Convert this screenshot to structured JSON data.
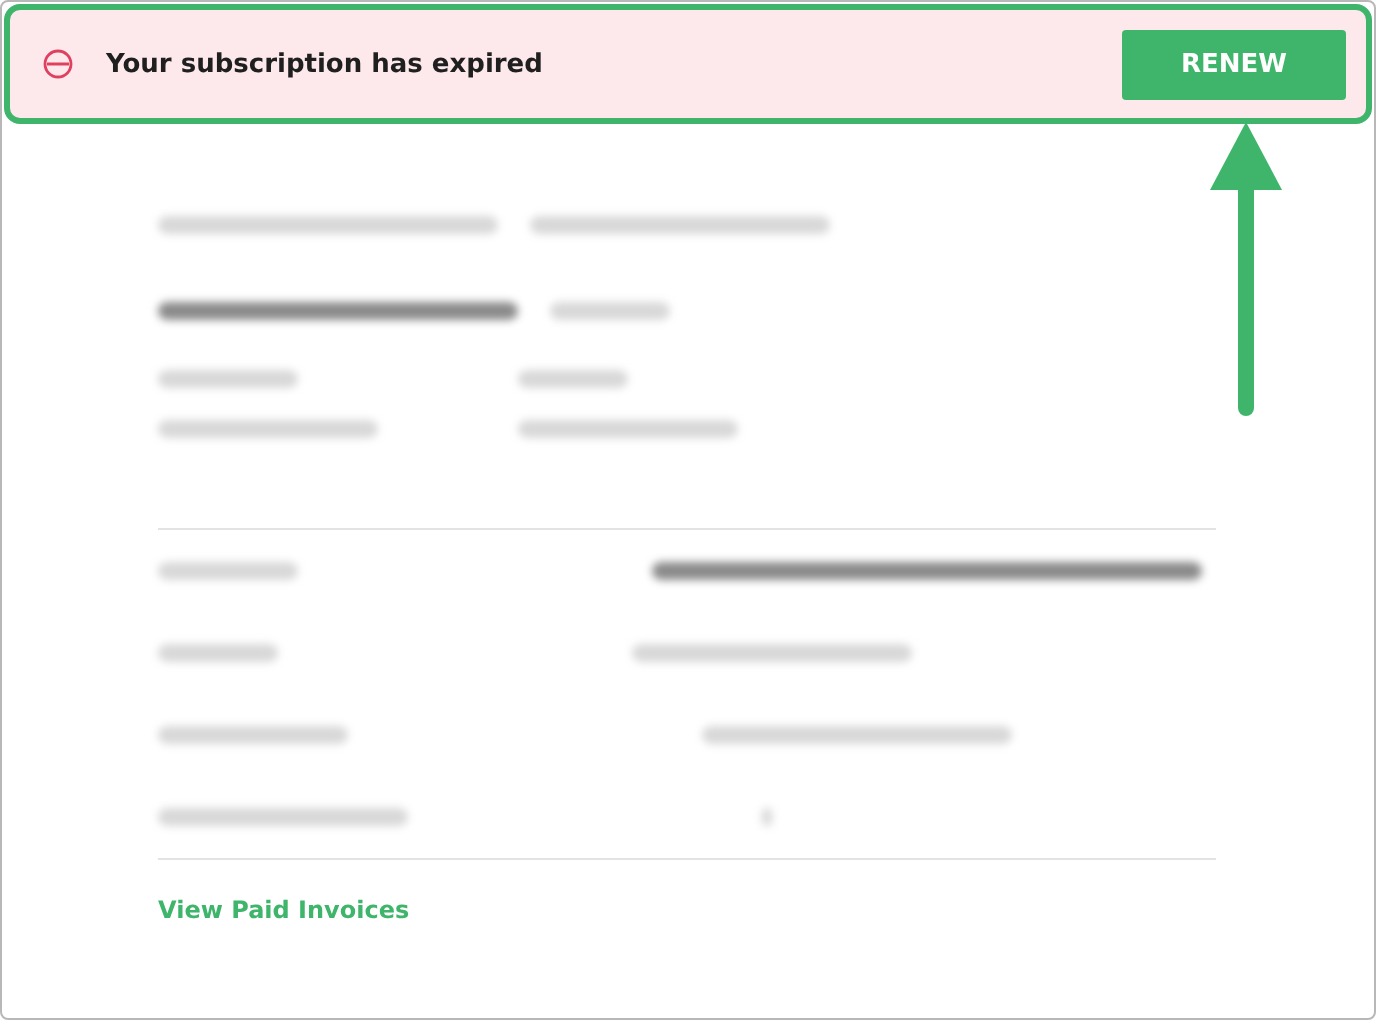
{
  "banner": {
    "message": "Your subscription has expired",
    "button": "RENEW"
  },
  "link": "View Paid Invoices"
}
